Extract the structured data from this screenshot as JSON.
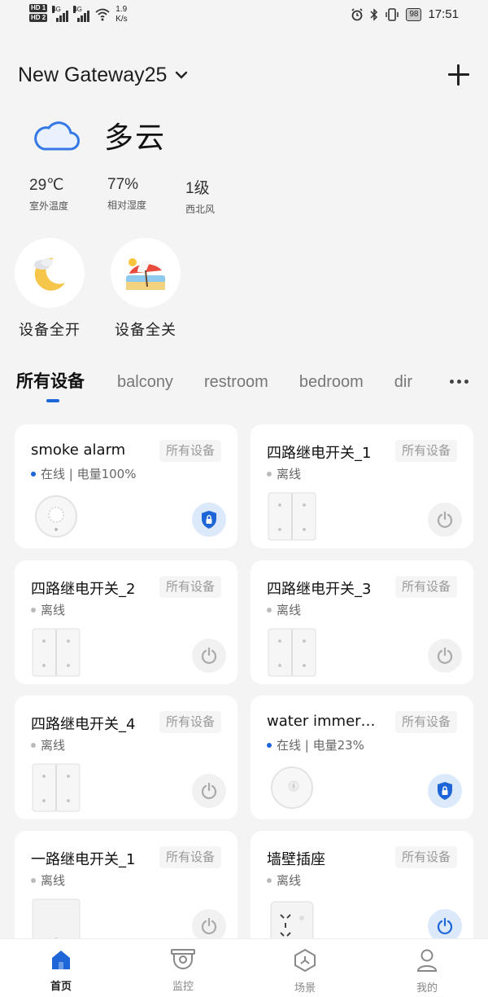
{
  "status_bar": {
    "sim1": "HD 1",
    "sim2": "HD 2",
    "net1": "4G",
    "net2": "4G",
    "speed_value": "1.9",
    "speed_unit": "K/s",
    "battery": "98",
    "time": "17:51"
  },
  "header": {
    "gateway_name": "New Gateway25"
  },
  "weather": {
    "condition": "多云",
    "stats": [
      {
        "value": "29℃",
        "label": "室外温度"
      },
      {
        "value": "77%",
        "label": "相对湿度"
      },
      {
        "value": "1级",
        "label": "西北风"
      }
    ]
  },
  "scenes": [
    {
      "label": "设备全开",
      "icon": "moon-icon"
    },
    {
      "label": "设备全关",
      "icon": "beach-umbrella-icon"
    }
  ],
  "tabs": [
    "所有设备",
    "balcony",
    "restroom",
    "bedroom",
    "dir"
  ],
  "devices": [
    {
      "name": "smoke alarm",
      "room": "所有设备",
      "status": "在线 | 电量100%",
      "online": true,
      "action": "security-shield-icon"
    },
    {
      "name": "四路继电开关_1",
      "room": "所有设备",
      "status": "离线",
      "online": false,
      "action": "power-icon"
    },
    {
      "name": "四路继电开关_2",
      "room": "所有设备",
      "status": "离线",
      "online": false,
      "action": "power-icon"
    },
    {
      "name": "四路继电开关_3",
      "room": "所有设备",
      "status": "离线",
      "online": false,
      "action": "power-icon"
    },
    {
      "name": "四路继电开关_4",
      "room": "所有设备",
      "status": "离线",
      "online": false,
      "action": "power-icon"
    },
    {
      "name": "water immer…",
      "room": "所有设备",
      "status": "在线 | 电量23%",
      "online": true,
      "action": "security-shield-icon"
    },
    {
      "name": "一路继电开关_1",
      "room": "所有设备",
      "status": "离线",
      "online": false,
      "action": "power-icon"
    },
    {
      "name": "墙壁插座",
      "room": "所有设备",
      "status": "离线",
      "online": false,
      "action": "power-icon"
    }
  ],
  "bottom_nav": [
    {
      "label": "首页",
      "icon": "home-icon",
      "active": true
    },
    {
      "label": "监控",
      "icon": "camera-icon",
      "active": false
    },
    {
      "label": "场景",
      "icon": "scene-icon",
      "active": false
    },
    {
      "label": "我的",
      "icon": "user-icon",
      "active": false
    }
  ],
  "colors": {
    "accent": "#1e66d8",
    "background": "#f4f4f4",
    "card": "#ffffff"
  }
}
